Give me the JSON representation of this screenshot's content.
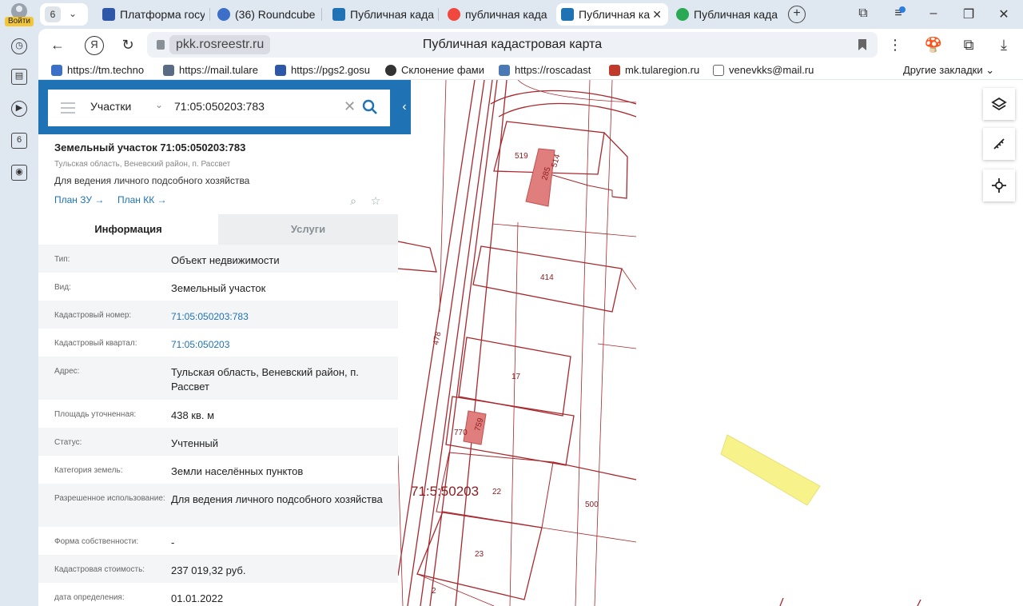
{
  "browser": {
    "profile_label": "Войти",
    "tab_group_count": "6",
    "tabs": [
      {
        "title": "Платформа госу",
        "color": "#2f57a8"
      },
      {
        "title": "(36) Roundcube",
        "color": "#3b6fc8"
      },
      {
        "title": "Публичная када",
        "color": "#1f72b4"
      },
      {
        "title": "публичная када",
        "color": "#f0483e"
      },
      {
        "title": "Публичная ка",
        "color": "#1f72b4",
        "active": true
      },
      {
        "title": "Публичная када",
        "color": "#2aa853"
      }
    ],
    "url_host": "pkk.rosreestr.ru",
    "page_title": "Публичная кадастровая карта",
    "rail_badge": "6",
    "bookmarks": [
      {
        "label": "https://tm.techno",
        "color": "#3b6fc8"
      },
      {
        "label": "https://mail.tulare",
        "color": "#5b6b84"
      },
      {
        "label": "https://pgs2.gosu",
        "color": "#2f57a8"
      },
      {
        "label": "Склонение фами",
        "color": "#333333"
      },
      {
        "label": "https://roscadast",
        "color": "#4a79b5"
      },
      {
        "label": "mk.tularegion.ru",
        "color": "#c0392b"
      },
      {
        "label": "venevkks@mail.ru",
        "color": "#666666"
      }
    ],
    "other_bookmarks": "Другие закладки"
  },
  "search": {
    "type": "Участки",
    "value": "71:05:050203:783"
  },
  "parcel": {
    "title": "Земельный участок 71:05:050203:783",
    "address": "Тульская область, Веневский район, п. Рассвет",
    "use": "Для ведения личного подсобного хозяйства",
    "plan_zu": "План ЗУ →",
    "plan_kk": "План КК →"
  },
  "tabs": {
    "info": "Информация",
    "services": "Услуги"
  },
  "rows": [
    {
      "k": "Тип:",
      "v": "Объект недвижимости"
    },
    {
      "k": "Вид:",
      "v": "Земельный участок"
    },
    {
      "k": "Кадастровый номер:",
      "v": "71:05:050203:783"
    },
    {
      "k": "Кадастровый квартал:",
      "v": "71:05:050203"
    },
    {
      "k": "Адрес:",
      "v": "Тульская область, Веневский район, п. Рассвет"
    },
    {
      "k": "Площадь уточненная:",
      "v": "438 кв. м"
    },
    {
      "k": "Статус:",
      "v": "Учтенный"
    },
    {
      "k": "Категория земель:",
      "v": "Земли населённых пунктов"
    },
    {
      "k": "Разрешенное использование:",
      "v": "Для ведения личного подсобного хозяйства"
    },
    {
      "k": "Форма собственности:",
      "v": "-"
    },
    {
      "k": "Кадастровая стоимость:",
      "v": "237 019,32 руб."
    },
    {
      "k": "дата определения:",
      "v": "01.01.2022"
    }
  ],
  "map": {
    "quarter_label": "71:5:50203",
    "parcel_numbers": [
      "519",
      "285",
      "514",
      "414",
      "478",
      "17",
      "770",
      "759",
      "22",
      "500",
      "23",
      "2"
    ],
    "line_color": "#a8282d",
    "building_color": "#e07e7e",
    "selected_color": "#f7f38a"
  }
}
